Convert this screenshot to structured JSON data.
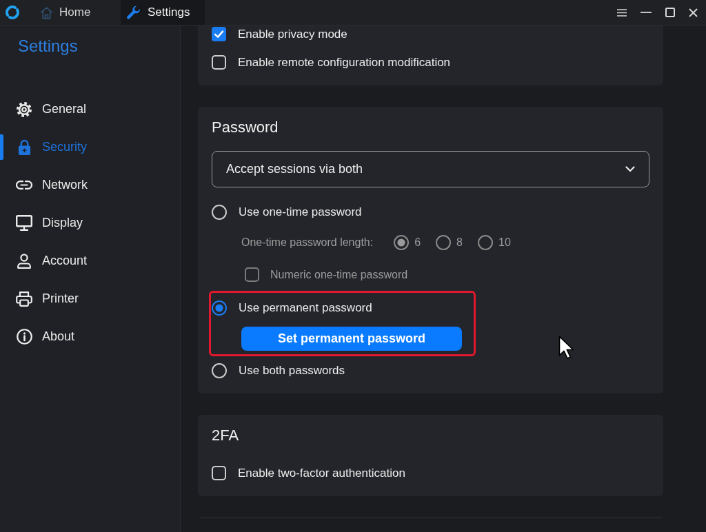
{
  "tabs": [
    {
      "label": "Home",
      "selected": false
    },
    {
      "label": "Settings",
      "selected": true
    }
  ],
  "sidebar": {
    "title": "Settings",
    "items": [
      {
        "label": "General",
        "selected": false
      },
      {
        "label": "Security",
        "selected": true
      },
      {
        "label": "Network",
        "selected": false
      },
      {
        "label": "Display",
        "selected": false
      },
      {
        "label": "Account",
        "selected": false
      },
      {
        "label": "Printer",
        "selected": false
      },
      {
        "label": "About",
        "selected": false
      }
    ]
  },
  "sections": [
    {
      "items": [
        {
          "kind": "checkbox",
          "label": "Enable privacy mode",
          "checked": true
        },
        {
          "kind": "checkbox",
          "label": "Enable remote configuration modification",
          "checked": false
        }
      ]
    },
    {
      "title": "Password",
      "items": [
        {
          "kind": "select",
          "value": "Accept sessions via both"
        },
        {
          "kind": "radio",
          "label": "Use one-time password",
          "selected": false,
          "highlighted": false,
          "children": [
            {
              "kind": "choice",
              "label": "One-time password length:",
              "disabled": true,
              "options": [
                {
                  "label": "6",
                  "selected": true
                },
                {
                  "label": "8",
                  "selected": false
                },
                {
                  "label": "10",
                  "selected": false
                }
              ]
            },
            {
              "kind": "checkbox",
              "label": "Numeric one-time password",
              "checked": false,
              "disabled": true
            }
          ]
        },
        {
          "kind": "radio",
          "label": "Use permanent password",
          "selected": true,
          "highlighted": true,
          "children": [
            {
              "kind": "button",
              "label": "Set permanent password"
            }
          ]
        },
        {
          "kind": "radio",
          "label": "Use both passwords",
          "selected": false,
          "highlighted": false
        }
      ]
    },
    {
      "title": "2FA",
      "items": [
        {
          "kind": "checkbox",
          "label": "Enable two-factor authentication",
          "checked": false
        }
      ]
    }
  ]
}
